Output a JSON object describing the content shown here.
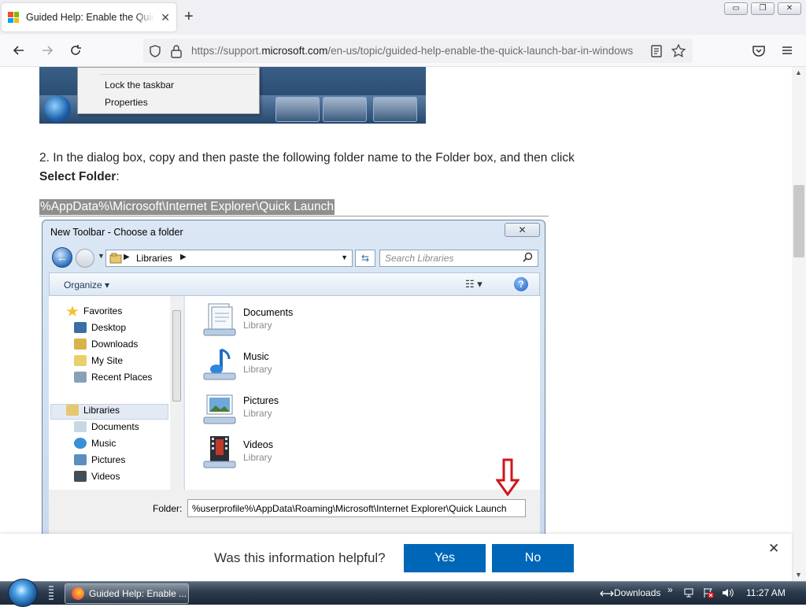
{
  "browser": {
    "tab_title": "Guided Help: Enable the Quick Launch Bar",
    "tab_close": "✕",
    "new_tab": "+",
    "url_prefix": "https://support.",
    "url_domain": "microsoft.com",
    "url_path": "/en-us/topic/guided-help-enable-the-quick-launch-bar-in-windows",
    "window_buttons": [
      "▭",
      "❐",
      "✕"
    ]
  },
  "context_menu": {
    "items": [
      "Lock the taskbar",
      "Properties"
    ]
  },
  "article": {
    "step_text": "2. In the dialog box, copy and then paste the following folder name to the Folder box, and then click ",
    "step_bold": "Select Folder",
    "step_end": ":",
    "folder_path": "%AppData%\\Microsoft\\Internet Explorer\\Quick Launch"
  },
  "dialog": {
    "title": "New Toolbar - Choose a folder",
    "close": "✕",
    "address": "Libraries",
    "search_placeholder": "Search Libraries",
    "organize": "Organize ▾",
    "help": "?",
    "nav_items": [
      {
        "label": "Favorites",
        "color": "#f5c12e"
      },
      {
        "label": "Desktop",
        "color": "#3a6ea5"
      },
      {
        "label": "Downloads",
        "color": "#d9b24a"
      },
      {
        "label": "My Site",
        "color": "#e8d06a"
      },
      {
        "label": "Recent Places",
        "color": "#8aa0b8"
      },
      {
        "label": "Libraries",
        "color": "#e7c872"
      },
      {
        "label": "Documents",
        "color": "#c9d6e4"
      },
      {
        "label": "Music",
        "color": "#3a8fd6"
      },
      {
        "label": "Pictures",
        "color": "#5a8fc0"
      },
      {
        "label": "Videos",
        "color": "#444c58"
      }
    ],
    "libraries": [
      {
        "name": "Documents",
        "type": "Library"
      },
      {
        "name": "Music",
        "type": "Library"
      },
      {
        "name": "Pictures",
        "type": "Library"
      },
      {
        "name": "Videos",
        "type": "Library"
      }
    ],
    "folder_label": "Folder:",
    "folder_value": "%userprofile%\\AppData\\Roaming\\Microsoft\\Internet Explorer\\Quick Launch"
  },
  "feedback": {
    "question": "Was this information helpful?",
    "yes": "Yes",
    "no": "No",
    "close": "✕"
  },
  "taskbar": {
    "task_label": "Guided Help: Enable ...",
    "downloads": "Downloads",
    "chevron": "»",
    "clock": "11:27 AM"
  },
  "colors": {
    "accent": "#0067b8",
    "highlight": "#8f8f8f"
  }
}
